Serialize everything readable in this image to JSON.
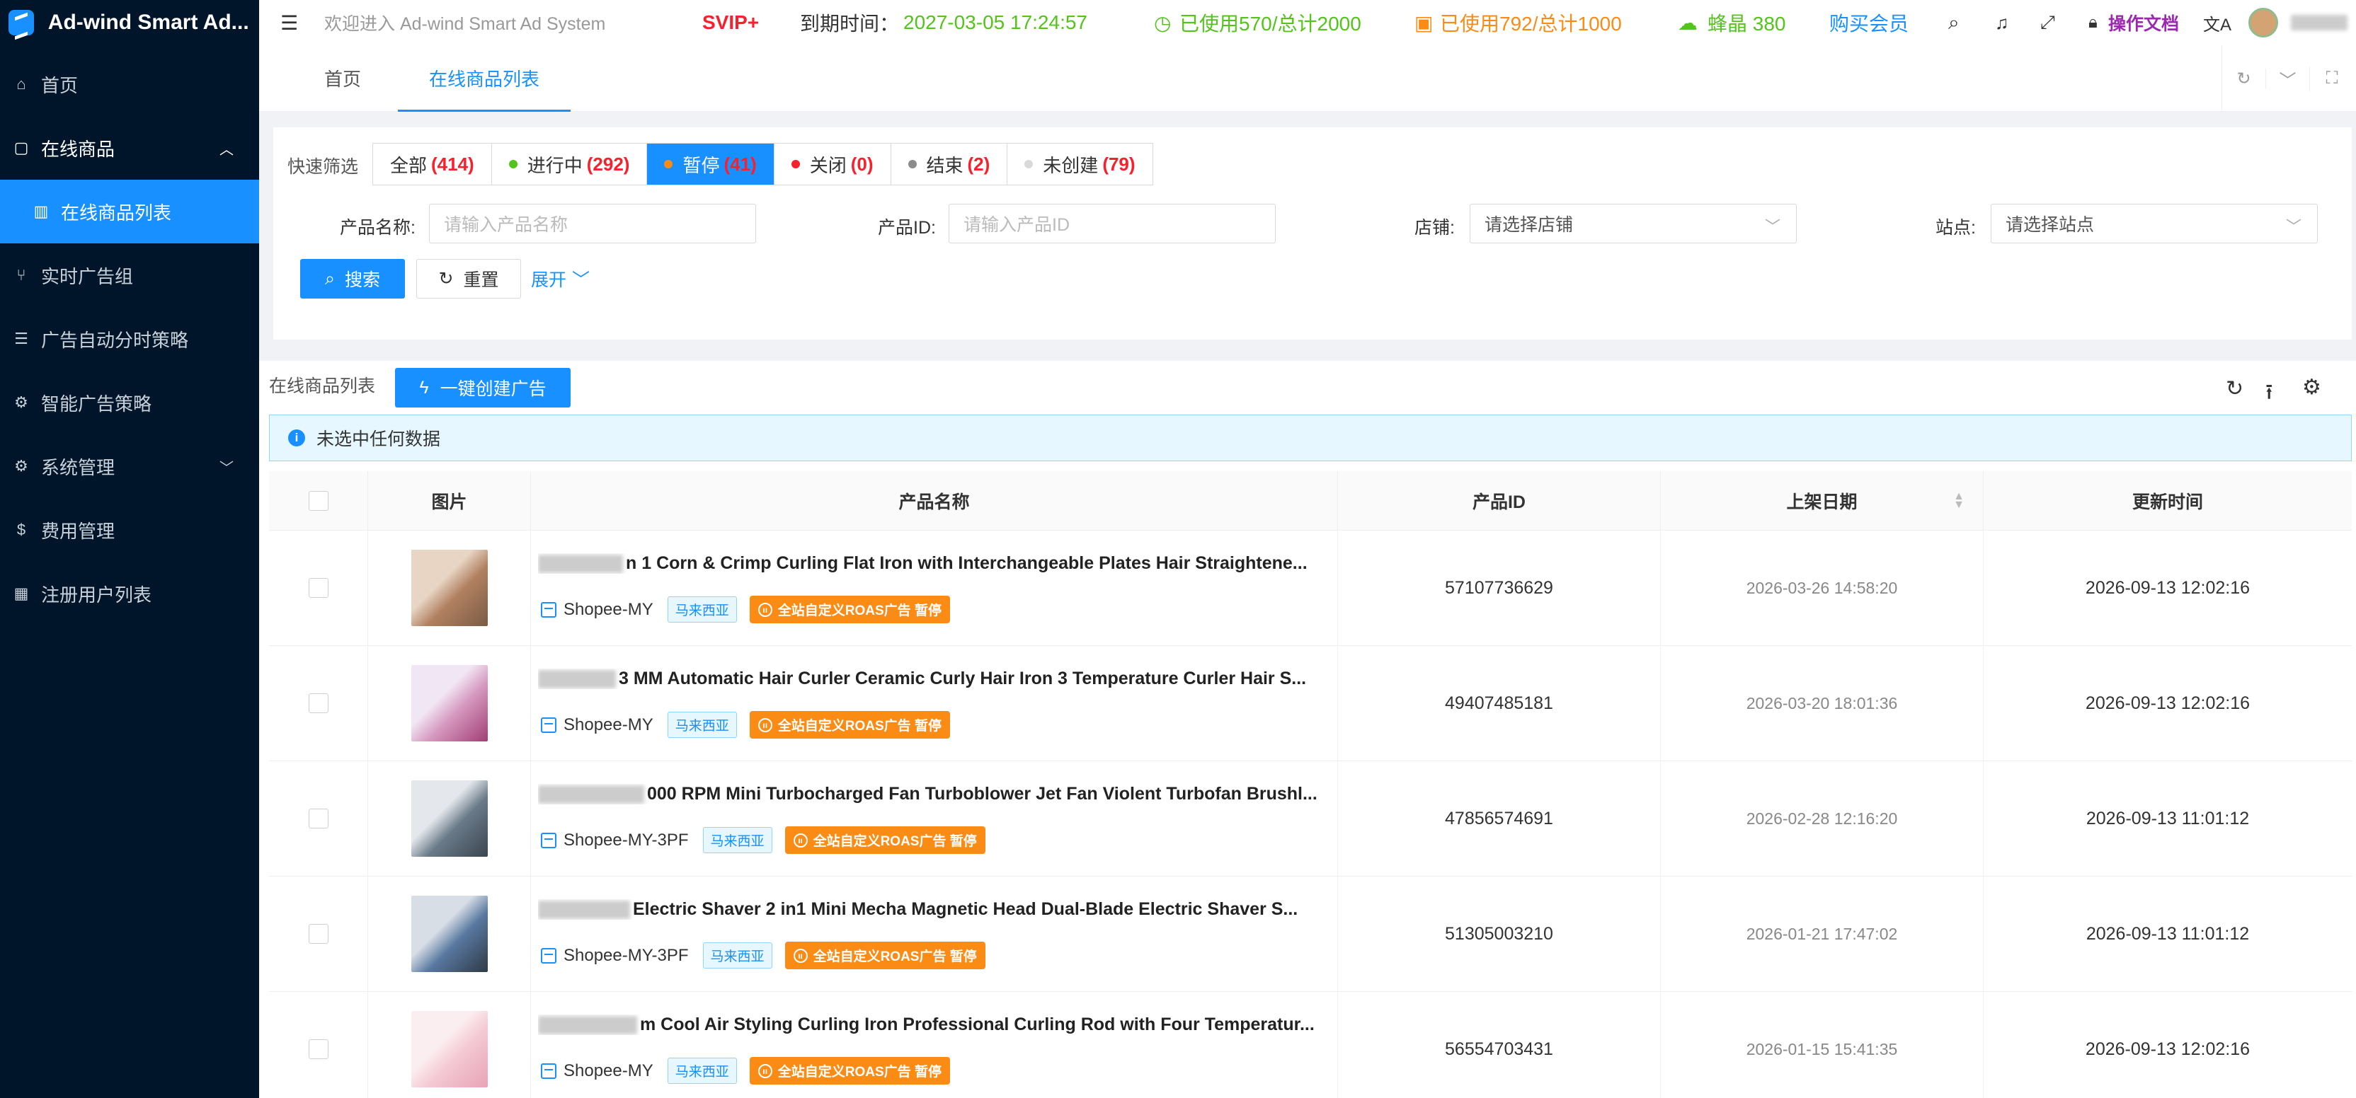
{
  "app": {
    "title": "Ad-wind Smart Ad..."
  },
  "sidebar": {
    "items": [
      {
        "label": "首页",
        "icon": "bank-icon"
      },
      {
        "label": "在线商品",
        "icon": "bag-icon"
      },
      {
        "label": "在线商品列表",
        "icon": "barcode-icon"
      },
      {
        "label": "实时广告组",
        "icon": "branch-icon"
      },
      {
        "label": "广告自动分时策略",
        "icon": "list-icon"
      },
      {
        "label": "智能广告策略",
        "icon": "gear-icon"
      },
      {
        "label": "系统管理",
        "icon": "gear-icon"
      },
      {
        "label": "费用管理",
        "icon": "dollar-icon"
      },
      {
        "label": "注册用户列表",
        "icon": "grid-icon"
      }
    ]
  },
  "header": {
    "welcome": "欢迎进入 Ad-wind Smart Ad System",
    "svip": "SVIP+",
    "expire_label": "到期时间：",
    "expire_value": "2027-03-05 17:24:57",
    "usage1": "已使用570/总计2000",
    "usage2": "已使用792/总计1000",
    "crystal": "蜂晶 380",
    "buy": "购买会员",
    "docs": "操作文档"
  },
  "tabs": [
    {
      "label": "首页"
    },
    {
      "label": "在线商品列表"
    }
  ],
  "quick_filter": {
    "label": "快速筛选",
    "options": [
      {
        "label": "全部",
        "count": "(414)",
        "dot": ""
      },
      {
        "label": "进行中",
        "count": "(292)",
        "dot": "#52c41a"
      },
      {
        "label": "暂停",
        "count": "(41)",
        "dot": "#fa8c16"
      },
      {
        "label": "关闭",
        "count": "(0)",
        "dot": "#f5222d"
      },
      {
        "label": "结束",
        "count": "(2)",
        "dot": "#8c8c8c"
      },
      {
        "label": "未创建",
        "count": "(79)",
        "dot": "#d9d9d9"
      }
    ]
  },
  "search": {
    "product_name_label": "产品名称:",
    "product_name_placeholder": "请输入产品名称",
    "product_id_label": "产品ID:",
    "product_id_placeholder": "请输入产品ID",
    "shop_label": "店铺:",
    "shop_placeholder": "请选择店铺",
    "site_label": "站点:",
    "site_placeholder": "请选择站点",
    "search_btn": "搜索",
    "reset_btn": "重置",
    "expand": "展开"
  },
  "table": {
    "title": "在线商品列表",
    "create_btn": "一键创建广告",
    "alert": "未选中任何数据",
    "columns": [
      "图片",
      "产品名称",
      "产品ID",
      "上架日期",
      "更新时间"
    ],
    "rows": [
      {
        "name": "n 1 Corn & Crimp Curling Flat Iron with Interchangeable Plates Hair Straightene...",
        "shop": "Shopee-MY",
        "country": "马来西亚",
        "ad": "全站自定义ROAS广告 暂停",
        "id": "57107736629",
        "listed": "2026-03-26 14:58:20",
        "updated": "2026-09-13 12:02:16"
      },
      {
        "name": "3 MM Automatic Hair Curler Ceramic Curly Hair Iron 3 Temperature Curler Hair S...",
        "shop": "Shopee-MY",
        "country": "马来西亚",
        "ad": "全站自定义ROAS广告 暂停",
        "id": "49407485181",
        "listed": "2026-03-20 18:01:36",
        "updated": "2026-09-13 12:02:16"
      },
      {
        "name": "000 RPM Mini Turbocharged Fan Turboblower Jet Fan Violent Turbofan Brushl...",
        "shop": "Shopee-MY-3PF",
        "country": "马来西亚",
        "ad": "全站自定义ROAS广告 暂停",
        "id": "47856574691",
        "listed": "2026-02-28 12:16:20",
        "updated": "2026-09-13 11:01:12"
      },
      {
        "name": "Electric Shaver 2 in1 Mini Mecha Magnetic Head Dual-Blade Electric Shaver S...",
        "shop": "Shopee-MY-3PF",
        "country": "马来西亚",
        "ad": "全站自定义ROAS广告 暂停",
        "id": "51305003210",
        "listed": "2026-01-21 17:47:02",
        "updated": "2026-09-13 11:01:12"
      },
      {
        "name": "m Cool Air Styling Curling Iron Professional Curling Rod with Four Temperatur...",
        "shop": "Shopee-MY",
        "country": "马来西亚",
        "ad": "全站自定义ROAS广告 暂停",
        "id": "56554703431",
        "listed": "2026-01-15 15:41:35",
        "updated": "2026-09-13 12:02:16"
      }
    ]
  }
}
